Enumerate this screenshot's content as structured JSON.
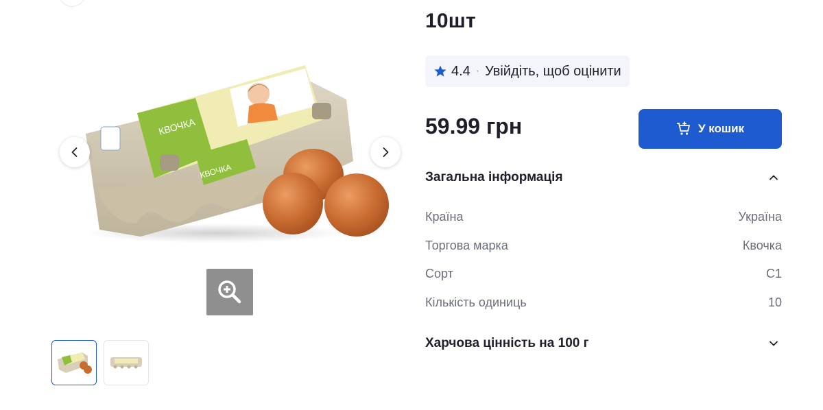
{
  "product": {
    "title": "10шт",
    "rating": {
      "value": "4.4",
      "separator": "·",
      "login_prompt": "Увійдіть, щоб оцінити"
    },
    "price": "59.99 грн",
    "cart_button_label": "У кошик"
  },
  "gallery": {
    "thumbnails": [
      "eggs-carton-front",
      "eggs-carton-side"
    ],
    "active_index": 0,
    "package_brand": "КВОЧКА"
  },
  "sections": {
    "general_info": {
      "label": "Загальна інформація",
      "expanded": true,
      "rows": [
        {
          "key": "Країна",
          "value": "Україна"
        },
        {
          "key": "Торгова марка",
          "value": "Квочка"
        },
        {
          "key": "Сорт",
          "value": "С1"
        },
        {
          "key": "Кількість одиниць",
          "value": "10"
        }
      ]
    },
    "nutrition": {
      "label": "Харчова цінність на 100 г",
      "expanded": false
    }
  },
  "colors": {
    "accent": "#1e5bd0",
    "text": "#1f1f2b",
    "muted": "#6b6e78",
    "rating_bg": "#f3f5fa",
    "zoom_bg": "#8f8f8f"
  }
}
